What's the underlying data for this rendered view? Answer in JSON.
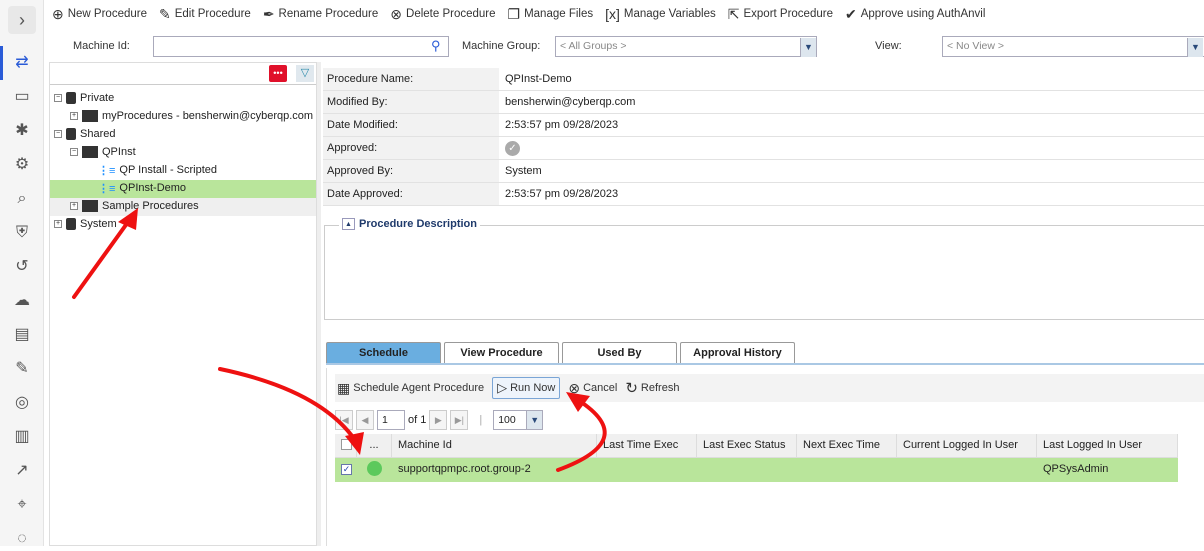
{
  "toolbar": {
    "items": [
      {
        "label": "New Procedure",
        "icon": "plus-circle-icon"
      },
      {
        "label": "Edit Procedure",
        "icon": "edit-icon"
      },
      {
        "label": "Rename Procedure",
        "icon": "pen-icon"
      },
      {
        "label": "Delete Procedure",
        "icon": "delete-circle-icon"
      },
      {
        "label": "Manage Files",
        "icon": "files-icon"
      },
      {
        "label": "Manage Variables",
        "icon": "variables-icon"
      },
      {
        "label": "Export Procedure",
        "icon": "export-icon"
      },
      {
        "label": "Approve using AuthAnvil",
        "icon": "check-circle-icon"
      }
    ]
  },
  "filters": {
    "machine_id_label": "Machine Id:",
    "machine_id_value": "",
    "machine_group_label": "Machine Group:",
    "machine_group_value": "< All Groups >",
    "view_label": "View:",
    "view_value": "< No View >"
  },
  "tree": {
    "search_value": "",
    "nodes": [
      {
        "label": "Private"
      },
      {
        "label": "myProcedures - bensherwin@cyberqp.com"
      },
      {
        "label": "Shared"
      },
      {
        "label": "QPInst"
      },
      {
        "label": "QP Install - Scripted"
      },
      {
        "label": "QPInst-Demo",
        "selected": true
      },
      {
        "label": "Sample Procedures"
      },
      {
        "label": "System"
      }
    ]
  },
  "details": {
    "rows": [
      {
        "key": "Procedure Name:",
        "value": "QPInst-Demo"
      },
      {
        "key": "Modified By:",
        "value": "bensherwin@cyberqp.com"
      },
      {
        "key": "Date Modified:",
        "value": "2:53:57 pm 09/28/2023"
      },
      {
        "key": "Approved:",
        "value": ""
      },
      {
        "key": "Approved By:",
        "value": "System"
      },
      {
        "key": "Date Approved:",
        "value": "2:53:57 pm 09/28/2023"
      }
    ],
    "description_title": "Procedure Description"
  },
  "tabs": [
    {
      "label": "Schedule",
      "active": true
    },
    {
      "label": "View Procedure"
    },
    {
      "label": "Used By"
    },
    {
      "label": "Approval History"
    }
  ],
  "actions": {
    "schedule": "Schedule Agent Procedure",
    "run_now": "Run Now",
    "cancel": "Cancel",
    "refresh": "Refresh"
  },
  "pager": {
    "page": "1",
    "of": "of 1",
    "page_size": "100"
  },
  "grid": {
    "columns": [
      "",
      "...",
      "Machine Id",
      "Last Time Exec",
      "Last Exec Status",
      "Next Exec Time",
      "Current Logged In User",
      "Last Logged In User"
    ],
    "rows": [
      {
        "checked": true,
        "status_color": "#5cc95c",
        "machine_id": "supportqpmpc.root.group-2",
        "last_time_exec": "",
        "last_exec_status": "",
        "next_exec_time": "",
        "current_user": "",
        "last_user": "QPSysAdmin"
      }
    ]
  },
  "colors": {
    "selection": "#b9e59b",
    "active_tab": "#6aaee0",
    "annotation_arrow": "#ee1111"
  }
}
